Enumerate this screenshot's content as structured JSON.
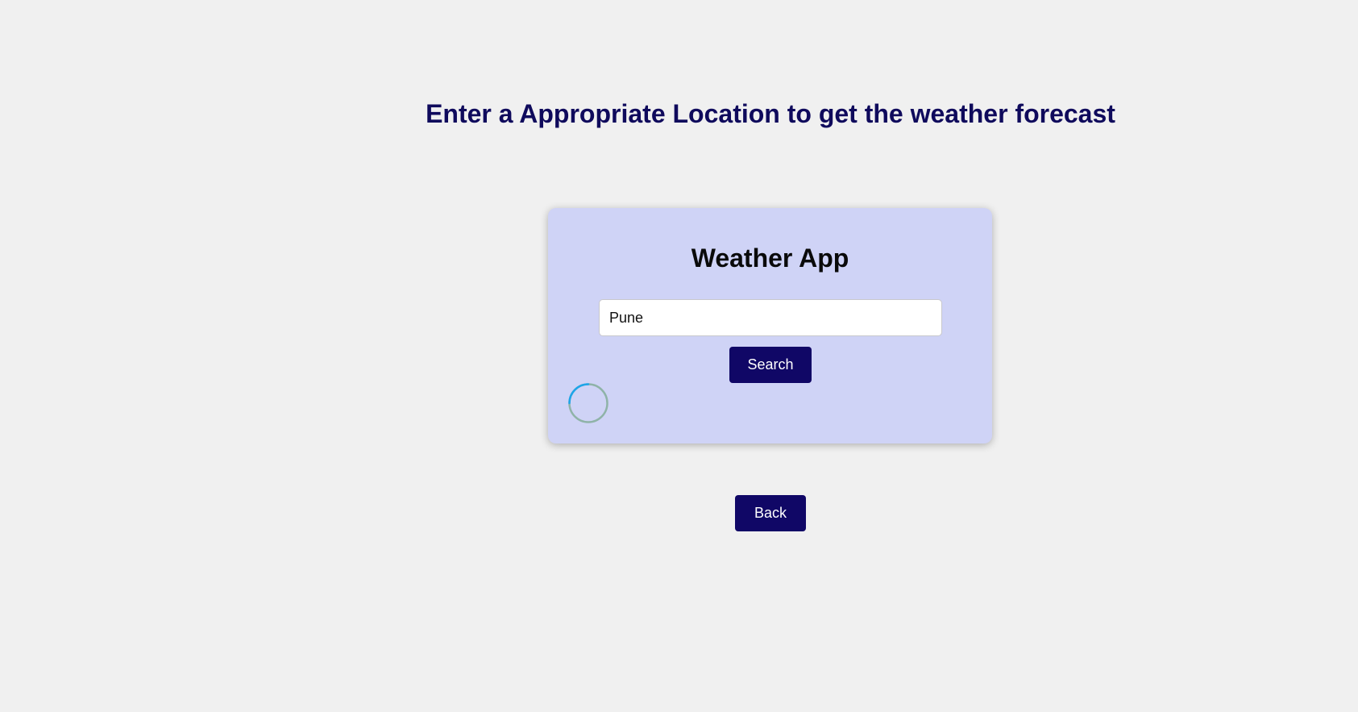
{
  "page": {
    "heading": "Enter a Appropriate Location to get the weather forecast"
  },
  "card": {
    "title": "Weather App",
    "input": {
      "value": "Pune",
      "placeholder": ""
    },
    "search_label": "Search",
    "loading_icon": "loading-spinner-icon"
  },
  "back_label": "Back",
  "colors": {
    "background": "#f0f0f0",
    "heading": "#0f0a5c",
    "card": "#cfd3f6",
    "button": "#100766",
    "spinner_track": "#8fb3a8",
    "spinner_arc": "#1ea5e9"
  }
}
